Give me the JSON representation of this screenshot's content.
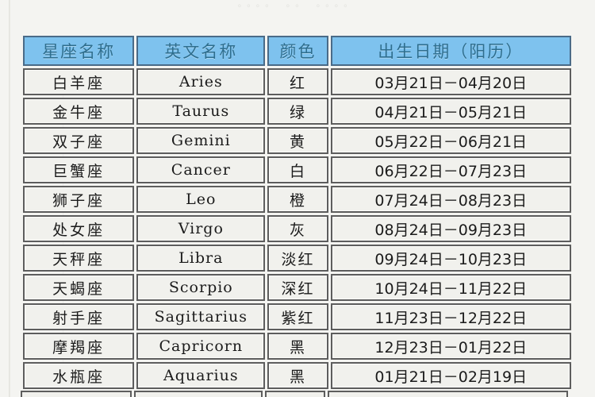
{
  "page": {
    "background_color": "#f4f4f1",
    "top_clipped_text": "。。。。    。。    。。。。"
  },
  "table": {
    "name": "zodiac-sign-table",
    "header_background_color": "#7ec2ee",
    "header_text_color": "#2e6e8e",
    "cell_background_color": "#f1f1ed",
    "cell_border_color": "#5d5d5d",
    "columns": [
      {
        "key": "name",
        "label": "星座名称"
      },
      {
        "key": "en",
        "label": "英文名称"
      },
      {
        "key": "color",
        "label": "颜色"
      },
      {
        "key": "date",
        "label": "出生日期（阳历）"
      }
    ],
    "rows": [
      {
        "name": "白羊座",
        "en": "Aries",
        "color": "红",
        "date": "03月21日－04月20日"
      },
      {
        "name": "金牛座",
        "en": "Taurus",
        "color": "绿",
        "date": "04月21日－05月21日"
      },
      {
        "name": "双子座",
        "en": "Gemini",
        "color": "黄",
        "date": "05月22日－06月21日"
      },
      {
        "name": "巨蟹座",
        "en": "Cancer",
        "color": "白",
        "date": "06月22日－07月23日"
      },
      {
        "name": "狮子座",
        "en": "Leo",
        "color": "橙",
        "date": "07月24日－08月23日"
      },
      {
        "name": "处女座",
        "en": "Virgo",
        "color": "灰",
        "date": "08月24日－09月23日"
      },
      {
        "name": "天秤座",
        "en": "Libra",
        "color": "淡红",
        "date": "09月24日－10月23日"
      },
      {
        "name": "天蝎座",
        "en": "Scorpio",
        "color": "深红",
        "date": "10月24日－11月22日"
      },
      {
        "name": "射手座",
        "en": "Sagittarius",
        "color": "紫红",
        "date": "11月23日－12月22日"
      },
      {
        "name": "摩羯座",
        "en": "Capricorn",
        "color": "黑",
        "date": "12月23日－01月22日"
      },
      {
        "name": "水瓶座",
        "en": "Aquarius",
        "color": "黑",
        "date": "01月21日－02月19日"
      }
    ]
  }
}
